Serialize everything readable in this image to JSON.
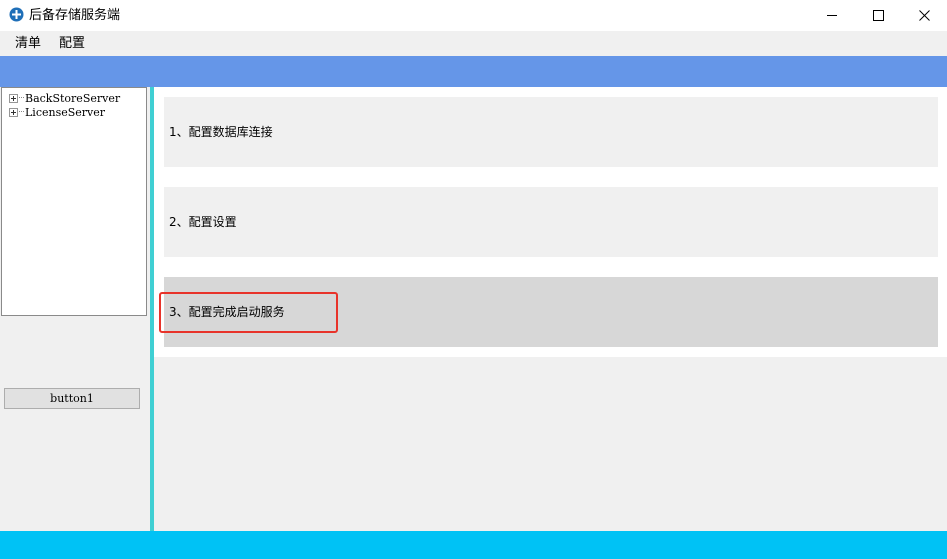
{
  "window": {
    "title": "后备存储服务端",
    "icon": "app-logo-icon",
    "controls": [
      "minimize-icon",
      "maximize-icon",
      "close-icon"
    ]
  },
  "menu": {
    "items": [
      {
        "label": "清单"
      },
      {
        "label": "配置"
      }
    ]
  },
  "tree": {
    "nodes": [
      {
        "label": "BackStoreServer",
        "expanded": false
      },
      {
        "label": "LicenseServer",
        "expanded": false
      }
    ]
  },
  "left_panel": {
    "button_label": "button1"
  },
  "steps": [
    {
      "label": "1、配置数据库连接",
      "active": false
    },
    {
      "label": "2、配置设置",
      "active": false
    },
    {
      "label": "3、配置完成启动服务",
      "active": true
    }
  ],
  "colors": {
    "header_band": "#6596e8",
    "splitter": "#3fcfd3",
    "status_bar": "#00c2f5",
    "highlight_border": "#e8332a",
    "active_step": "#d7d7d7"
  }
}
